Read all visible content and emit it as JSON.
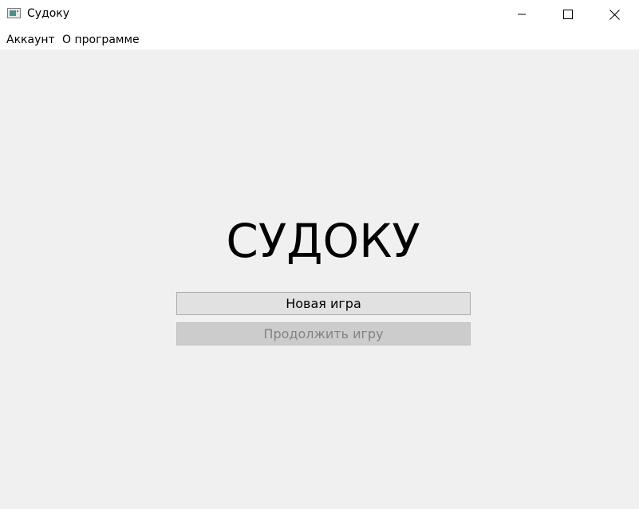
{
  "window": {
    "title": "Судоку",
    "icon": "app-window-icon",
    "controls": [
      "minimize-icon",
      "maximize-icon",
      "close-icon"
    ]
  },
  "menu": {
    "items": [
      {
        "label": "Аккаунт"
      },
      {
        "label": "О программе"
      }
    ]
  },
  "main": {
    "heading": "СУДОКУ",
    "new_game_label": "Новая игра",
    "continue_label": "Продолжить игру",
    "continue_enabled": false
  },
  "colors": {
    "background": "#f0f0f0",
    "titlebar": "#ffffff",
    "button": "#e1e1e1",
    "button_disabled": "#cccccc",
    "disabled_text": "#838383"
  }
}
